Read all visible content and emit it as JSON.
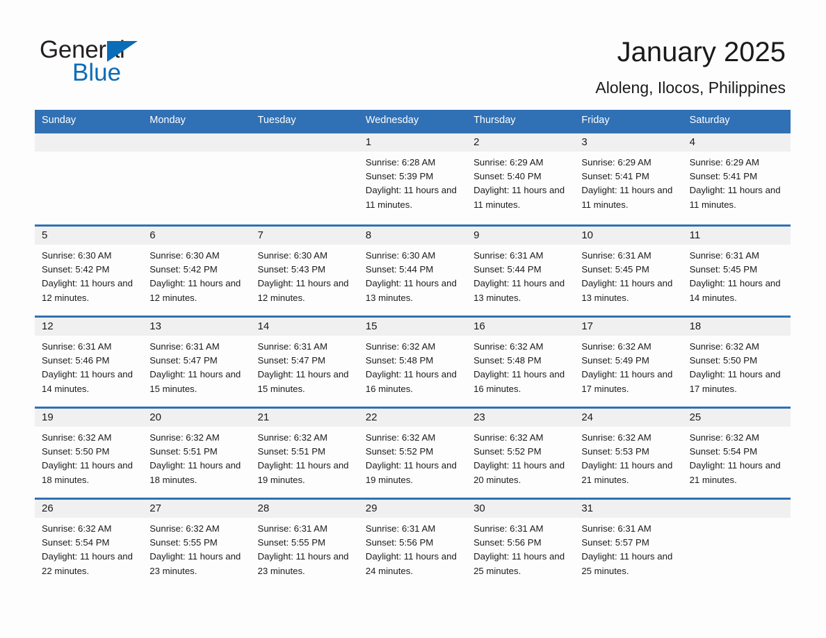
{
  "brand": {
    "name_part1": "General",
    "name_part2": "Blue",
    "triangle_color": "#0b6cb7"
  },
  "header": {
    "title": "January 2025",
    "subtitle": "Aloleng, Ilocos, Philippines",
    "accent_color": "#3070b4",
    "daynum_band_color": "#f0f0f0"
  },
  "weekdays": [
    "Sunday",
    "Monday",
    "Tuesday",
    "Wednesday",
    "Thursday",
    "Friday",
    "Saturday"
  ],
  "weeks": [
    [
      {
        "day": "",
        "sunrise": "",
        "sunset": "",
        "daylight": ""
      },
      {
        "day": "",
        "sunrise": "",
        "sunset": "",
        "daylight": ""
      },
      {
        "day": "",
        "sunrise": "",
        "sunset": "",
        "daylight": ""
      },
      {
        "day": "1",
        "sunrise": "Sunrise: 6:28 AM",
        "sunset": "Sunset: 5:39 PM",
        "daylight": "Daylight: 11 hours and 11 minutes."
      },
      {
        "day": "2",
        "sunrise": "Sunrise: 6:29 AM",
        "sunset": "Sunset: 5:40 PM",
        "daylight": "Daylight: 11 hours and 11 minutes."
      },
      {
        "day": "3",
        "sunrise": "Sunrise: 6:29 AM",
        "sunset": "Sunset: 5:41 PM",
        "daylight": "Daylight: 11 hours and 11 minutes."
      },
      {
        "day": "4",
        "sunrise": "Sunrise: 6:29 AM",
        "sunset": "Sunset: 5:41 PM",
        "daylight": "Daylight: 11 hours and 11 minutes."
      }
    ],
    [
      {
        "day": "5",
        "sunrise": "Sunrise: 6:30 AM",
        "sunset": "Sunset: 5:42 PM",
        "daylight": "Daylight: 11 hours and 12 minutes."
      },
      {
        "day": "6",
        "sunrise": "Sunrise: 6:30 AM",
        "sunset": "Sunset: 5:42 PM",
        "daylight": "Daylight: 11 hours and 12 minutes."
      },
      {
        "day": "7",
        "sunrise": "Sunrise: 6:30 AM",
        "sunset": "Sunset: 5:43 PM",
        "daylight": "Daylight: 11 hours and 12 minutes."
      },
      {
        "day": "8",
        "sunrise": "Sunrise: 6:30 AM",
        "sunset": "Sunset: 5:44 PM",
        "daylight": "Daylight: 11 hours and 13 minutes."
      },
      {
        "day": "9",
        "sunrise": "Sunrise: 6:31 AM",
        "sunset": "Sunset: 5:44 PM",
        "daylight": "Daylight: 11 hours and 13 minutes."
      },
      {
        "day": "10",
        "sunrise": "Sunrise: 6:31 AM",
        "sunset": "Sunset: 5:45 PM",
        "daylight": "Daylight: 11 hours and 13 minutes."
      },
      {
        "day": "11",
        "sunrise": "Sunrise: 6:31 AM",
        "sunset": "Sunset: 5:45 PM",
        "daylight": "Daylight: 11 hours and 14 minutes."
      }
    ],
    [
      {
        "day": "12",
        "sunrise": "Sunrise: 6:31 AM",
        "sunset": "Sunset: 5:46 PM",
        "daylight": "Daylight: 11 hours and 14 minutes."
      },
      {
        "day": "13",
        "sunrise": "Sunrise: 6:31 AM",
        "sunset": "Sunset: 5:47 PM",
        "daylight": "Daylight: 11 hours and 15 minutes."
      },
      {
        "day": "14",
        "sunrise": "Sunrise: 6:31 AM",
        "sunset": "Sunset: 5:47 PM",
        "daylight": "Daylight: 11 hours and 15 minutes."
      },
      {
        "day": "15",
        "sunrise": "Sunrise: 6:32 AM",
        "sunset": "Sunset: 5:48 PM",
        "daylight": "Daylight: 11 hours and 16 minutes."
      },
      {
        "day": "16",
        "sunrise": "Sunrise: 6:32 AM",
        "sunset": "Sunset: 5:48 PM",
        "daylight": "Daylight: 11 hours and 16 minutes."
      },
      {
        "day": "17",
        "sunrise": "Sunrise: 6:32 AM",
        "sunset": "Sunset: 5:49 PM",
        "daylight": "Daylight: 11 hours and 17 minutes."
      },
      {
        "day": "18",
        "sunrise": "Sunrise: 6:32 AM",
        "sunset": "Sunset: 5:50 PM",
        "daylight": "Daylight: 11 hours and 17 minutes."
      }
    ],
    [
      {
        "day": "19",
        "sunrise": "Sunrise: 6:32 AM",
        "sunset": "Sunset: 5:50 PM",
        "daylight": "Daylight: 11 hours and 18 minutes."
      },
      {
        "day": "20",
        "sunrise": "Sunrise: 6:32 AM",
        "sunset": "Sunset: 5:51 PM",
        "daylight": "Daylight: 11 hours and 18 minutes."
      },
      {
        "day": "21",
        "sunrise": "Sunrise: 6:32 AM",
        "sunset": "Sunset: 5:51 PM",
        "daylight": "Daylight: 11 hours and 19 minutes."
      },
      {
        "day": "22",
        "sunrise": "Sunrise: 6:32 AM",
        "sunset": "Sunset: 5:52 PM",
        "daylight": "Daylight: 11 hours and 19 minutes."
      },
      {
        "day": "23",
        "sunrise": "Sunrise: 6:32 AM",
        "sunset": "Sunset: 5:52 PM",
        "daylight": "Daylight: 11 hours and 20 minutes."
      },
      {
        "day": "24",
        "sunrise": "Sunrise: 6:32 AM",
        "sunset": "Sunset: 5:53 PM",
        "daylight": "Daylight: 11 hours and 21 minutes."
      },
      {
        "day": "25",
        "sunrise": "Sunrise: 6:32 AM",
        "sunset": "Sunset: 5:54 PM",
        "daylight": "Daylight: 11 hours and 21 minutes."
      }
    ],
    [
      {
        "day": "26",
        "sunrise": "Sunrise: 6:32 AM",
        "sunset": "Sunset: 5:54 PM",
        "daylight": "Daylight: 11 hours and 22 minutes."
      },
      {
        "day": "27",
        "sunrise": "Sunrise: 6:32 AM",
        "sunset": "Sunset: 5:55 PM",
        "daylight": "Daylight: 11 hours and 23 minutes."
      },
      {
        "day": "28",
        "sunrise": "Sunrise: 6:31 AM",
        "sunset": "Sunset: 5:55 PM",
        "daylight": "Daylight: 11 hours and 23 minutes."
      },
      {
        "day": "29",
        "sunrise": "Sunrise: 6:31 AM",
        "sunset": "Sunset: 5:56 PM",
        "daylight": "Daylight: 11 hours and 24 minutes."
      },
      {
        "day": "30",
        "sunrise": "Sunrise: 6:31 AM",
        "sunset": "Sunset: 5:56 PM",
        "daylight": "Daylight: 11 hours and 25 minutes."
      },
      {
        "day": "31",
        "sunrise": "Sunrise: 6:31 AM",
        "sunset": "Sunset: 5:57 PM",
        "daylight": "Daylight: 11 hours and 25 minutes."
      },
      {
        "day": "",
        "sunrise": "",
        "sunset": "",
        "daylight": ""
      }
    ]
  ]
}
